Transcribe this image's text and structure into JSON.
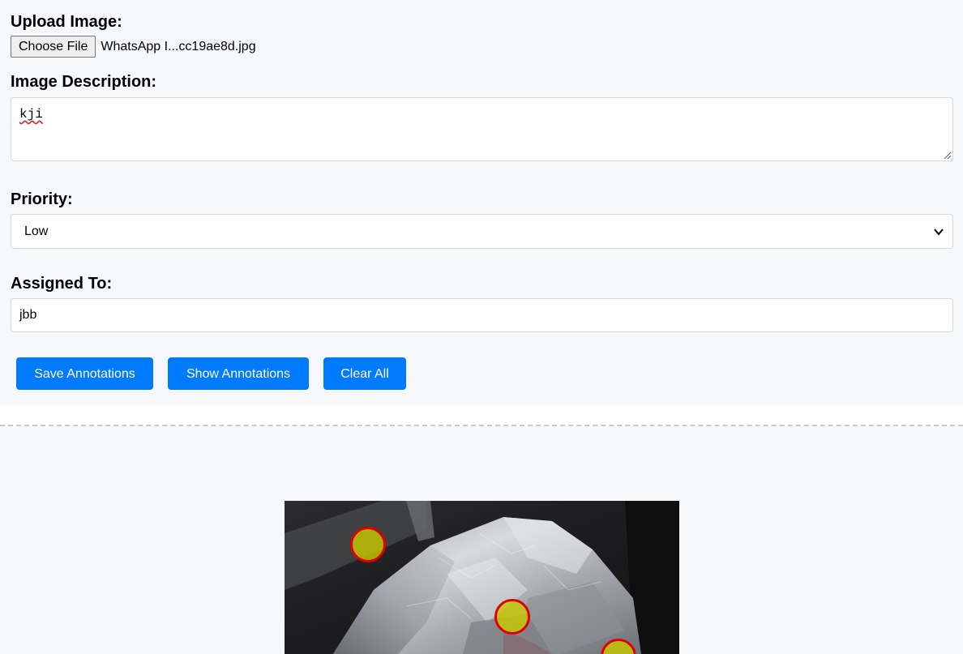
{
  "upload": {
    "label": "Upload Image:",
    "button_label": "Choose File",
    "file_name": "WhatsApp I...cc19ae8d.jpg"
  },
  "description": {
    "label": "Image Description:",
    "value": "kji"
  },
  "priority": {
    "label": "Priority:",
    "selected": "Low"
  },
  "assigned": {
    "label": "Assigned To:",
    "value": "jbb"
  },
  "actions": {
    "save": "Save Annotations",
    "show": "Show Annotations",
    "clear": "Clear All"
  },
  "annotations": {
    "marker_count": 3,
    "marker_fill": "#c8c800",
    "marker_border": "#e00000"
  },
  "colors": {
    "accent": "#007bff",
    "page_bg": "#f7f8fa"
  }
}
